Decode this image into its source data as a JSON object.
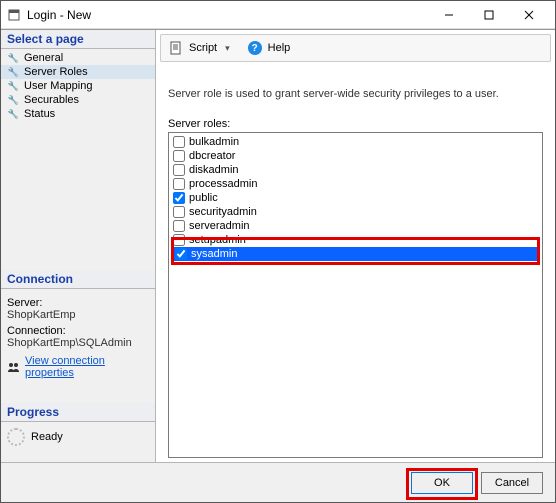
{
  "window": {
    "title": "Login - New"
  },
  "left": {
    "pagesHeader": "Select a page",
    "pages": [
      {
        "label": "General"
      },
      {
        "label": "Server Roles"
      },
      {
        "label": "User Mapping"
      },
      {
        "label": "Securables"
      },
      {
        "label": "Status"
      }
    ],
    "connectionHeader": "Connection",
    "serverLabel": "Server:",
    "serverValue": "ShopKartEmp",
    "connectionLabel": "Connection:",
    "connectionValue": "ShopKartEmp\\SQLAdmin",
    "viewConn": "View connection properties",
    "progressHeader": "Progress",
    "progressText": "Ready"
  },
  "toolbar": {
    "script": "Script",
    "help": "Help"
  },
  "main": {
    "description": "Server role is used to grant server-wide security privileges to a user.",
    "rolesLabel": "Server roles:",
    "roles": [
      {
        "name": "bulkadmin",
        "checked": false
      },
      {
        "name": "dbcreator",
        "checked": false
      },
      {
        "name": "diskadmin",
        "checked": false
      },
      {
        "name": "processadmin",
        "checked": false
      },
      {
        "name": "public",
        "checked": true
      },
      {
        "name": "securityadmin",
        "checked": false
      },
      {
        "name": "serveradmin",
        "checked": false
      },
      {
        "name": "setupadmin",
        "checked": false
      },
      {
        "name": "sysadmin",
        "checked": true,
        "selected": true
      }
    ]
  },
  "buttons": {
    "ok": "OK",
    "cancel": "Cancel"
  }
}
